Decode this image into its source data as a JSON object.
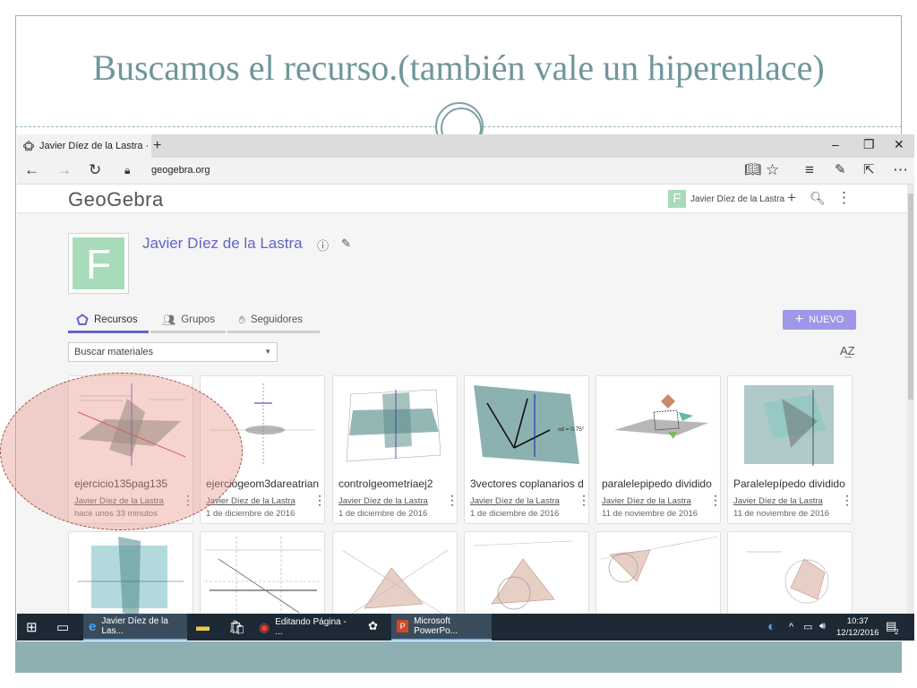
{
  "slide": {
    "title": "Buscamos el recurso.(también vale un hiperenlace)"
  },
  "browser": {
    "tab_title": "Javier Díez de la Lastra ·",
    "new_tab": "+",
    "minimize": "–",
    "restore": "❐",
    "close": "✕",
    "url": "geogebra.org"
  },
  "header": {
    "logo": "GeoGebra",
    "avatar_letter": "F",
    "user_name": "Javier Díez de la Lastra"
  },
  "profile": {
    "avatar_letter": "F",
    "name": "Javier Díez de la Lastra"
  },
  "tabs": [
    {
      "label": "Recursos"
    },
    {
      "label": "Grupos"
    },
    {
      "label": "Seguidores"
    }
  ],
  "new_button": {
    "label": "NUEVO"
  },
  "search": {
    "value": "Buscar materiales"
  },
  "sort": {
    "label": "A͢Z"
  },
  "cards": [
    {
      "title": "ejercicio135pag135",
      "author": "Javier Díez de la Lastra",
      "date": "hace unos 33 minutos"
    },
    {
      "title": "ejerciogeom3dareatrian",
      "author": "Javier Díez de la Lastra",
      "date": "1 de diciembre de 2016"
    },
    {
      "title": "controlgeometriaej2",
      "author": "Javier Díez de la Lastra",
      "date": "1 de diciembre de 2016"
    },
    {
      "title": "3vectores coplanarios d",
      "author": "Javier Díez de la Lastra",
      "date": "1 de diciembre de 2016"
    },
    {
      "title": "paralelepipedo dividido",
      "author": "Javier Díez de la Lastra",
      "date": "11 de noviembre de 2016"
    },
    {
      "title": "Paralelepípedo dividido",
      "author": "Javier Díez de la Lastra",
      "date": "11 de noviembre de 2016"
    }
  ],
  "thumb_text": {
    "cd_label": "cd = 0.75°"
  },
  "taskbar": {
    "items": [
      {
        "label": "Javier Díez de la Las..."
      },
      {
        "label": "Editando Página - ..."
      },
      {
        "label": "Microsoft PowerPo..."
      }
    ],
    "time": "10:37",
    "date": "12/12/2016",
    "notif_count": "2"
  },
  "colors": {
    "accent": "#6662c9",
    "new_button": "#9f97e8",
    "avatar": "#a8dbb9",
    "slide_title": "#6f969b",
    "highlight": "#e8968c"
  }
}
